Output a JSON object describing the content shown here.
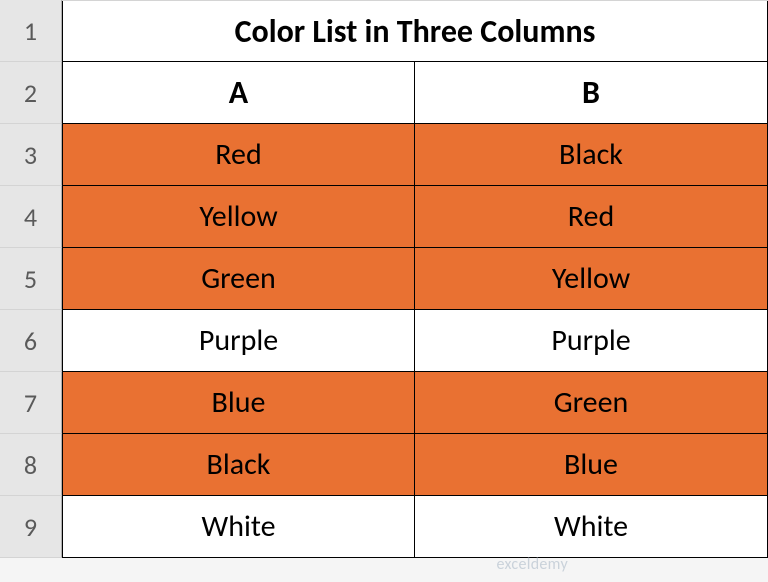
{
  "row_headers": [
    "1",
    "2",
    "3",
    "4",
    "5",
    "6",
    "7",
    "8",
    "9"
  ],
  "title": "Color List in Three Columns",
  "columns": {
    "a": "A",
    "b": "B"
  },
  "rows": [
    {
      "a": "Red",
      "b": "Black",
      "hl_a": true,
      "hl_b": true
    },
    {
      "a": "Yellow",
      "b": "Red",
      "hl_a": true,
      "hl_b": true
    },
    {
      "a": "Green",
      "b": "Yellow",
      "hl_a": true,
      "hl_b": true
    },
    {
      "a": "Purple",
      "b": "Purple",
      "hl_a": false,
      "hl_b": false
    },
    {
      "a": "Blue",
      "b": "Green",
      "hl_a": true,
      "hl_b": true
    },
    {
      "a": "Black",
      "b": "Blue",
      "hl_a": true,
      "hl_b": true
    },
    {
      "a": "White",
      "b": "White",
      "hl_a": false,
      "hl_b": false
    }
  ],
  "chart_data": {
    "type": "table",
    "title": "Color List in Three Columns",
    "columns": [
      "A",
      "B"
    ],
    "rows": [
      [
        "Red",
        "Black"
      ],
      [
        "Yellow",
        "Red"
      ],
      [
        "Green",
        "Yellow"
      ],
      [
        "Purple",
        "Purple"
      ],
      [
        "Blue",
        "Green"
      ],
      [
        "Black",
        "Blue"
      ],
      [
        "White",
        "White"
      ]
    ],
    "highlight_color": "#e97132",
    "highlighted_rows": [
      1,
      2,
      3,
      5,
      6
    ]
  },
  "watermark": "exceldemy"
}
